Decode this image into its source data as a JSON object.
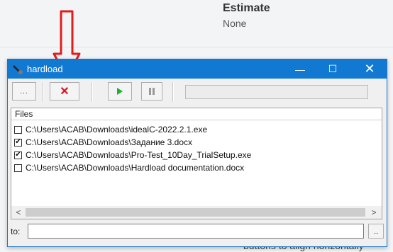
{
  "background": {
    "heading": "Estimate",
    "value": "None",
    "bottom_text": "buttons to align horizontally"
  },
  "window": {
    "title": "hardload",
    "controls": {
      "minimize": "—",
      "maximize": "☐",
      "close": "✕"
    }
  },
  "toolbar": {
    "browse_label": "...",
    "delete_label": "✕",
    "play_icon": "play-icon",
    "pause_icon": "pause-icon"
  },
  "list": {
    "header": "Files",
    "items": [
      {
        "path": "C:\\Users\\ACAB\\Downloads\\idealC-2022.2.1.exe",
        "checked": false
      },
      {
        "path": "C:\\Users\\ACAB\\Downloads\\Задание 3.docx",
        "checked": true
      },
      {
        "path": "C:\\Users\\ACAB\\Downloads\\Pro-Test_10Day_TrialSetup.exe",
        "checked": true
      },
      {
        "path": "C:\\Users\\ACAB\\Downloads\\Hardload documentation.docx",
        "checked": false
      }
    ],
    "scroll_left": "<",
    "scroll_right": ">"
  },
  "destination": {
    "label": "to:",
    "value": "",
    "browse_label": "..."
  },
  "colors": {
    "titlebar": "#1279d3",
    "delete": "#e3101e",
    "play": "#19b52a",
    "annotation": "#e31b1b"
  }
}
